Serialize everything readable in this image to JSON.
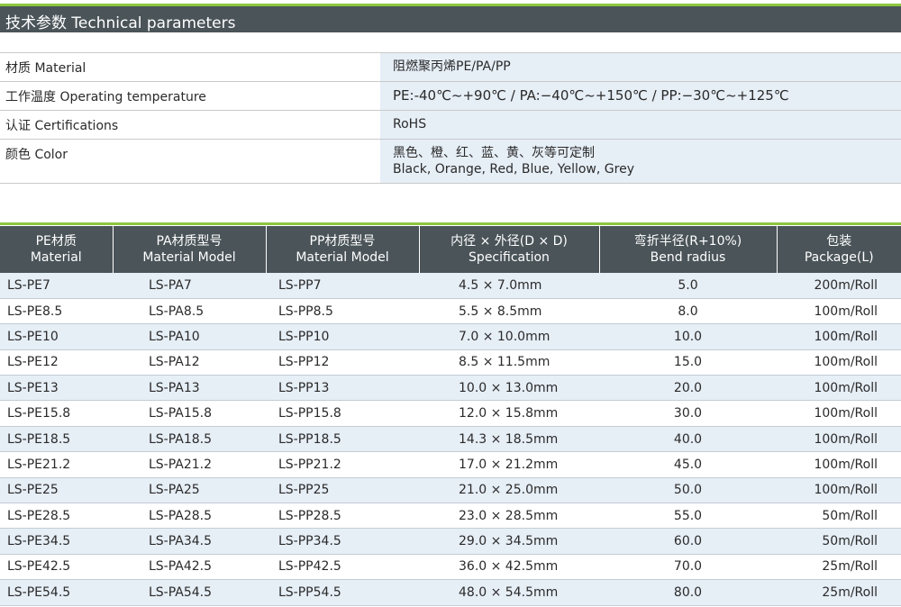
{
  "header": {
    "title": "技术参数  Technical parameters"
  },
  "parameters": [
    {
      "label": "材质 Material",
      "value": [
        "阻燃聚丙烯PE/PA/PP"
      ]
    },
    {
      "label": "工作温度 Operating temperature",
      "value": [
        "PE:-40℃~+90℃ / PA:−40℃~+150℃ / PP:−30℃~+125℃"
      ]
    },
    {
      "label": "认证 Certifications",
      "value": [
        "RoHS"
      ]
    },
    {
      "label": "颜色 Color",
      "value": [
        "黑色、橙、红、蓝、黄、灰等可定制",
        "Black, Orange, Red, Blue, Yellow, Grey"
      ]
    }
  ],
  "table": {
    "headers": [
      [
        "PE材质",
        "Material"
      ],
      [
        "PA材质型号",
        "Material Model"
      ],
      [
        "PP材质型号",
        "Material Model"
      ],
      [
        "内径 × 外径(D × D)",
        "Specification"
      ],
      [
        "弯折半径(R+10%)",
        "Bend radius"
      ],
      [
        "包装",
        "Package(L)"
      ]
    ],
    "rows": [
      [
        "LS-PE7",
        "LS-PA7",
        "LS-PP7",
        "4.5 × 7.0mm",
        "5.0",
        "200m/Roll"
      ],
      [
        "LS-PE8.5",
        "LS-PA8.5",
        "LS-PP8.5",
        "5.5 × 8.5mm",
        "8.0",
        "100m/Roll"
      ],
      [
        "LS-PE10",
        "LS-PA10",
        "LS-PP10",
        "7.0 × 10.0mm",
        "10.0",
        "100m/Roll"
      ],
      [
        "LS-PE12",
        "LS-PA12",
        "LS-PP12",
        "8.5 × 11.5mm",
        "15.0",
        "100m/Roll"
      ],
      [
        "LS-PE13",
        "LS-PA13",
        "LS-PP13",
        "10.0 × 13.0mm",
        "20.0",
        "100m/Roll"
      ],
      [
        "LS-PE15.8",
        "LS-PA15.8",
        "LS-PP15.8",
        "12.0 × 15.8mm",
        "30.0",
        "100m/Roll"
      ],
      [
        "LS-PE18.5",
        "LS-PA18.5",
        "LS-PP18.5",
        "14.3 × 18.5mm",
        "40.0",
        "100m/Roll"
      ],
      [
        "LS-PE21.2",
        "LS-PA21.2",
        "LS-PP21.2",
        "17.0 × 21.2mm",
        "45.0",
        "100m/Roll"
      ],
      [
        "LS-PE25",
        "LS-PA25",
        "LS-PP25",
        "21.0 × 25.0mm",
        "50.0",
        "100m/Roll"
      ],
      [
        "LS-PE28.5",
        "LS-PA28.5",
        "LS-PP28.5",
        "23.0 × 28.5mm",
        "55.0",
        "50m/Roll"
      ],
      [
        "LS-PE34.5",
        "LS-PA34.5",
        "LS-PP34.5",
        "29.0 × 34.5mm",
        "60.0",
        "50m/Roll"
      ],
      [
        "LS-PE42.5",
        "LS-PA42.5",
        "LS-PP42.5",
        "36.0 × 42.5mm",
        "70.0",
        "25m/Roll"
      ],
      [
        "LS-PE54.5",
        "LS-PA54.5",
        "LS-PP54.5",
        "48.0 × 54.5mm",
        "80.0",
        "25m/Roll"
      ]
    ]
  },
  "colors": {
    "header_bg": "#4a5459",
    "accent_green": "#8cc63f",
    "stripe_blue": "#e6eef6"
  }
}
